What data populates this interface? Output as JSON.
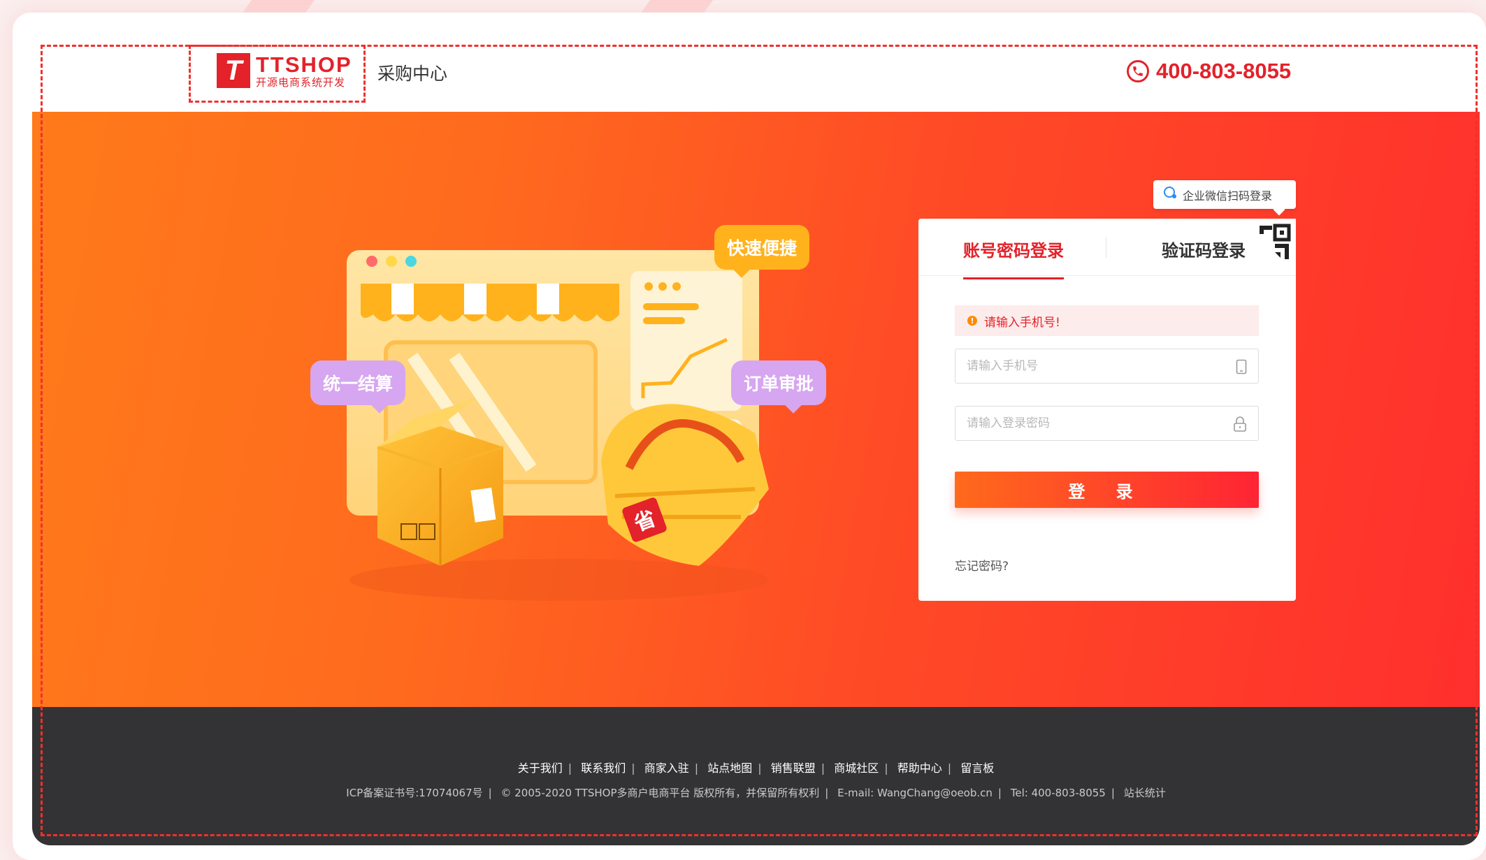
{
  "header": {
    "logo_mark": "T",
    "logo_title": "TTSHOP",
    "logo_subtitle": "开源电商系统开发",
    "title": "采购中心",
    "phone": "400-803-8055"
  },
  "illustration": {
    "bubble_fast": "快速便捷",
    "bubble_settle": "统一结算",
    "bubble_approve": "订单审批",
    "basket_tag": "省"
  },
  "login": {
    "qr_tip": "企业微信扫码登录",
    "tab_password": "账号密码登录",
    "tab_code": "验证码登录",
    "error_message": "请输入手机号!",
    "phone_placeholder": "请输入手机号",
    "phone_value": "",
    "password_placeholder": "请输入登录密码",
    "password_value": "",
    "submit_label": "登 录",
    "forgot_label": "忘记密码?"
  },
  "footer": {
    "links": [
      "关于我们",
      "联系我们",
      "商家入驻",
      "站点地图",
      "销售联盟",
      "商城社区",
      "帮助中心",
      "留言板"
    ],
    "copyright": [
      "ICP备案证书号:17074067号",
      "© 2005-2020 TTSHOP多商户电商平台 版权所有，并保留所有权利",
      "E-mail: WangChang@oeob.cn",
      "Tel: 400-803-8055",
      "站长统计"
    ],
    "separator": "|"
  },
  "colors": {
    "brand_red": "#e3222a",
    "banner_start": "#ff7a1a",
    "banner_end": "#ff2f2d",
    "footer_bg": "#333335"
  }
}
